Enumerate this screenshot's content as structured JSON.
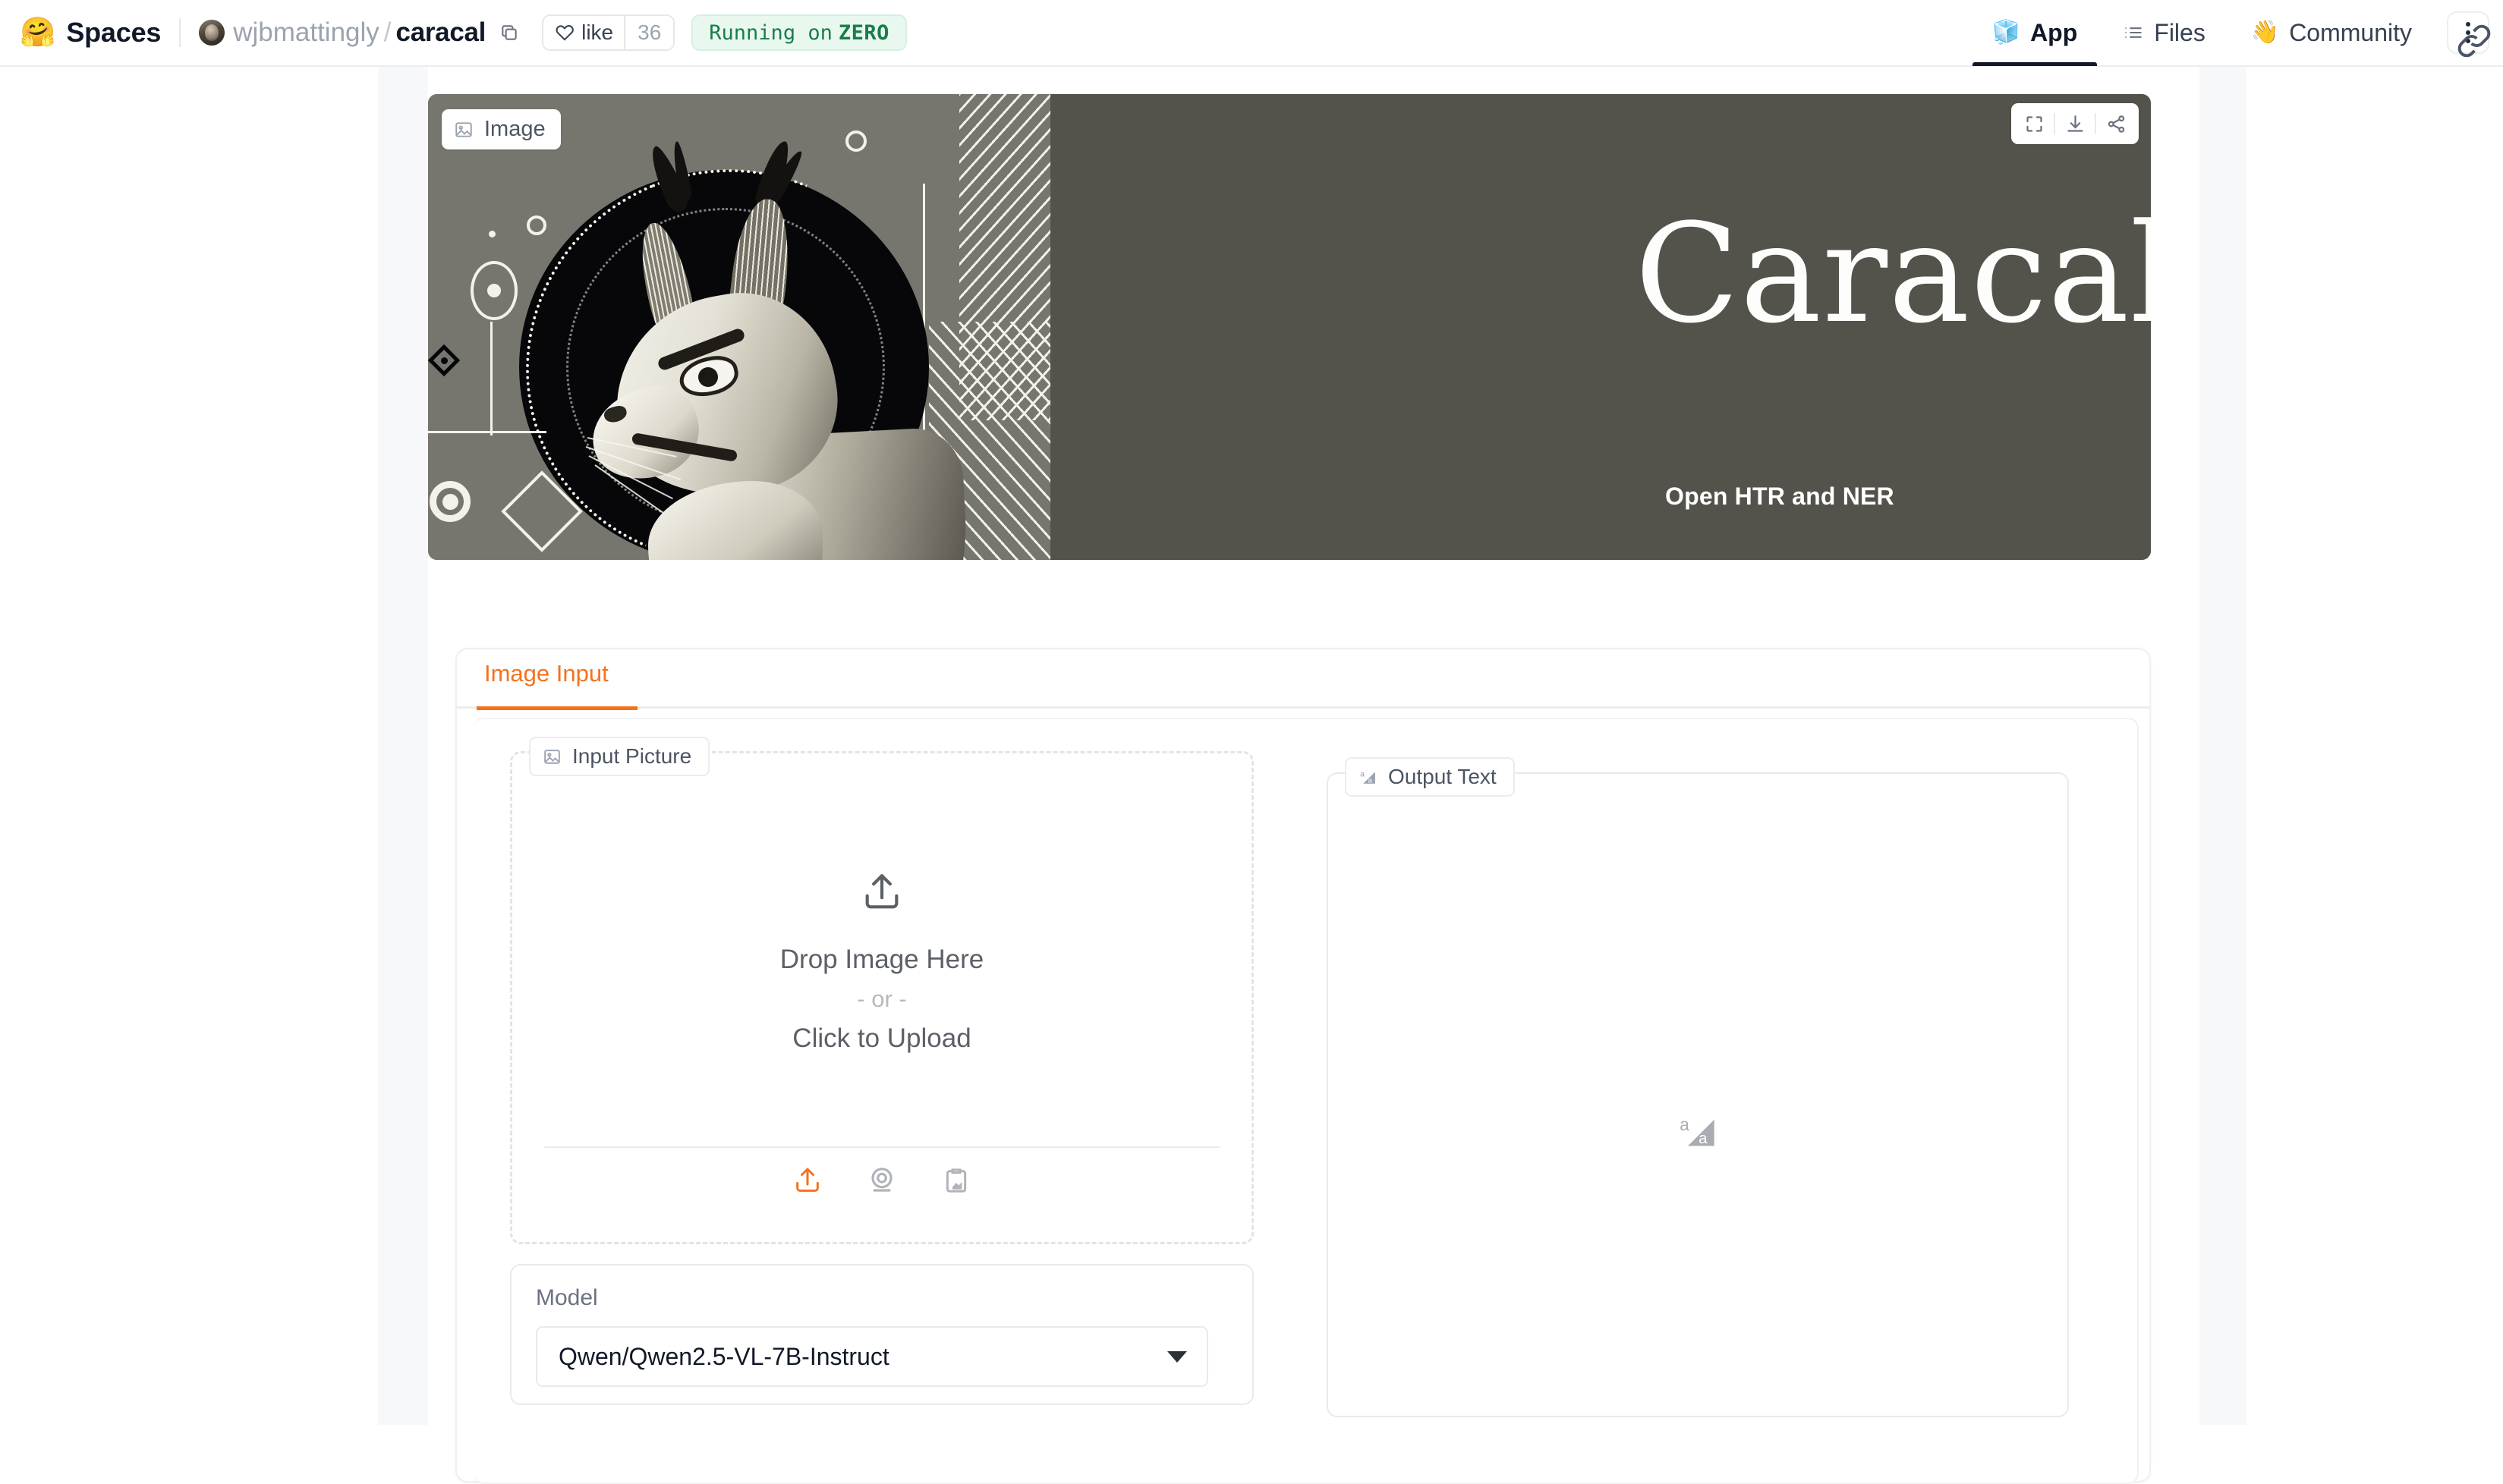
{
  "header": {
    "logo_icon": "hugging-face-logo",
    "product_label": "Spaces",
    "owner": "wjbmattingly",
    "separator": "/",
    "repo": "caracal",
    "copy_icon": "copy-icon",
    "like": {
      "icon": "heart-icon",
      "label": "like",
      "count": "36"
    },
    "status_badge": {
      "prefix": "Running on",
      "hardware": "ZERO"
    },
    "nav": [
      {
        "name": "app",
        "emoji": "🧊",
        "label": "App",
        "active": true
      },
      {
        "name": "files",
        "emoji": "",
        "label": "Files",
        "active": false
      },
      {
        "name": "community",
        "emoji": "👋",
        "label": "Community",
        "active": false
      }
    ],
    "overflow_icon": "kebab-menu-icon",
    "cursor_icon": "link-cursor-icon"
  },
  "banner": {
    "chip_label": "Image",
    "chip_icon": "image-icon",
    "title": "Caracal",
    "subtitle": "Open HTR and NER",
    "background_color": "#53524b",
    "art_alt": "caracal-illustration",
    "tools": [
      {
        "name": "fullscreen-icon",
        "label": "Fullscreen"
      },
      {
        "name": "download-icon",
        "label": "Download"
      },
      {
        "name": "share-icon",
        "label": "Share"
      }
    ]
  },
  "tabs": [
    {
      "name": "image-input",
      "label": "Image Input",
      "active": true
    }
  ],
  "input_picture": {
    "chip_label": "Input Picture",
    "chip_icon": "image-icon",
    "upload_icon": "upload-arrow-icon",
    "drop_text": "Drop Image Here",
    "or_text": "- or -",
    "click_text": "Click to Upload",
    "actions": [
      {
        "name": "upload-icon",
        "label": "Upload file",
        "color": "#f4721e"
      },
      {
        "name": "webcam-icon",
        "label": "Take photo"
      },
      {
        "name": "clipboard-paste-icon",
        "label": "Paste from clipboard"
      }
    ]
  },
  "model": {
    "label": "Model",
    "selected": "Qwen/Qwen2.5-VL-7B-Instruct",
    "caret_icon": "chevron-down-icon"
  },
  "output_text": {
    "chip_label": "Output Text",
    "chip_icon": "text-output-icon",
    "placeholder_icon": "text-output-icon",
    "value": ""
  },
  "colors": {
    "accent": "#f4721e",
    "banner_bg": "#53524b",
    "page_bg": "#ffffff",
    "gutter_bg": "#f7f8f9",
    "status_green": "#197d4b",
    "status_green_bg": "#e9f8ef"
  }
}
